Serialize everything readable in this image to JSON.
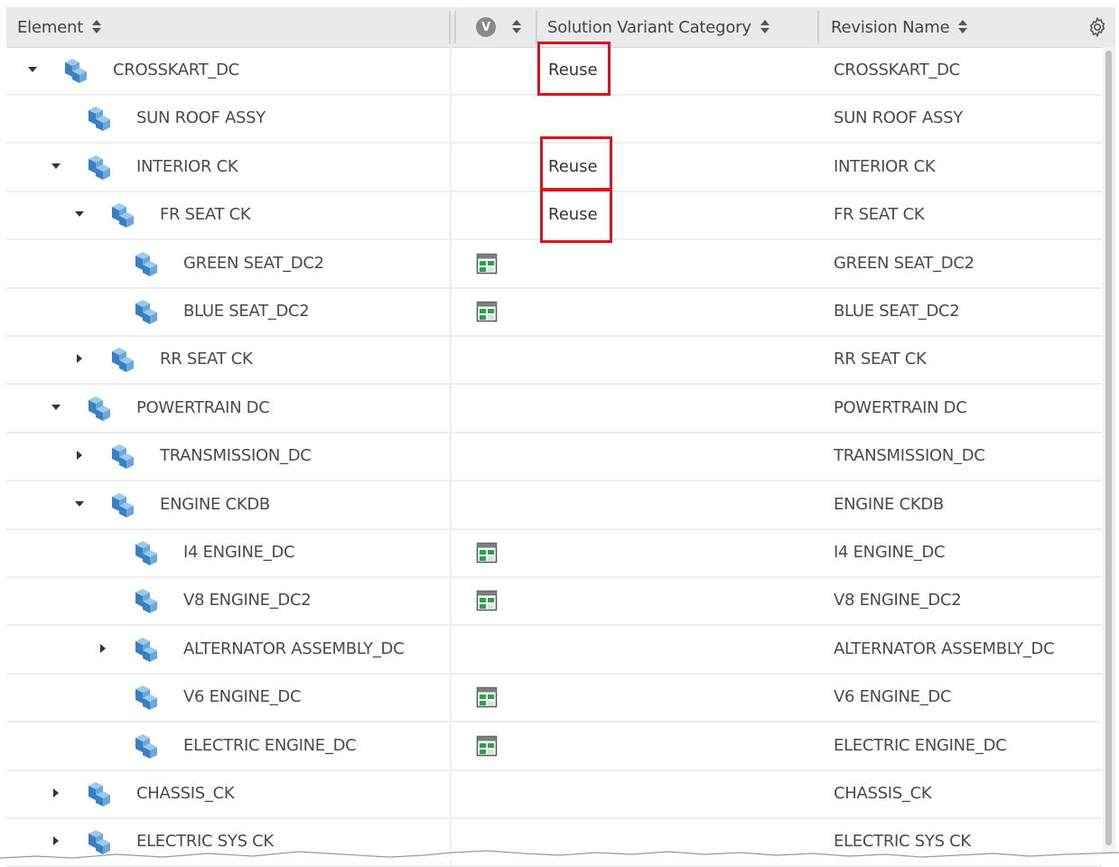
{
  "header": {
    "element_label": "Element",
    "variant_icon_glyph": "V",
    "category_label": "Solution Variant Category",
    "revision_label": "Revision Name"
  },
  "colors": {
    "highlight_box": "#e0101e",
    "header_bg": "#e9eaec",
    "icon_blue": "#3a7fc2",
    "icon_green": "#2e9f4a"
  },
  "rows": [
    {
      "element": "CROSSKART_DC",
      "revision": "CROSSKART_DC",
      "category": "Reuse",
      "twisty": "expanded",
      "level": 0,
      "variant_icon": false
    },
    {
      "element": "SUN ROOF ASSY",
      "revision": "SUN ROOF ASSY",
      "category": "",
      "twisty": "none",
      "level": 1,
      "variant_icon": false
    },
    {
      "element": "INTERIOR CK",
      "revision": "INTERIOR CK",
      "category": "Reuse",
      "twisty": "expanded",
      "level": 1,
      "variant_icon": false
    },
    {
      "element": "FR SEAT CK",
      "revision": "FR SEAT CK",
      "category": "Reuse",
      "twisty": "expanded",
      "level": 2,
      "variant_icon": false
    },
    {
      "element": "GREEN SEAT_DC2",
      "revision": "GREEN SEAT_DC2",
      "category": "",
      "twisty": "none",
      "level": 3,
      "variant_icon": true
    },
    {
      "element": "BLUE SEAT_DC2",
      "revision": "BLUE SEAT_DC2",
      "category": "",
      "twisty": "none",
      "level": 3,
      "variant_icon": true
    },
    {
      "element": "RR SEAT CK",
      "revision": "RR SEAT CK",
      "category": "",
      "twisty": "collapsed",
      "level": 2,
      "variant_icon": false
    },
    {
      "element": "POWERTRAIN DC",
      "revision": "POWERTRAIN DC",
      "category": "",
      "twisty": "expanded",
      "level": 1,
      "variant_icon": false
    },
    {
      "element": "TRANSMISSION_DC",
      "revision": "TRANSMISSION_DC",
      "category": "",
      "twisty": "collapsed",
      "level": 2,
      "variant_icon": false
    },
    {
      "element": "ENGINE CKDB",
      "revision": "ENGINE CKDB",
      "category": "",
      "twisty": "expanded",
      "level": 2,
      "variant_icon": false
    },
    {
      "element": "I4 ENGINE_DC",
      "revision": "I4 ENGINE_DC",
      "category": "",
      "twisty": "none",
      "level": 3,
      "variant_icon": true
    },
    {
      "element": "V8 ENGINE_DC2",
      "revision": "V8 ENGINE_DC2",
      "category": "",
      "twisty": "none",
      "level": 3,
      "variant_icon": true
    },
    {
      "element": "ALTERNATOR ASSEMBLY_DC",
      "revision": "ALTERNATOR ASSEMBLY_DC",
      "category": "",
      "twisty": "collapsed",
      "level": 3,
      "variant_icon": false
    },
    {
      "element": "V6 ENGINE_DC",
      "revision": "V6 ENGINE_DC",
      "category": "",
      "twisty": "none",
      "level": 3,
      "variant_icon": true
    },
    {
      "element": "ELECTRIC ENGINE_DC",
      "revision": "ELECTRIC ENGINE_DC",
      "category": "",
      "twisty": "none",
      "level": 3,
      "variant_icon": true
    },
    {
      "element": "CHASSIS_CK",
      "revision": "CHASSIS_CK",
      "category": "",
      "twisty": "collapsed",
      "level": 1,
      "variant_icon": false
    },
    {
      "element": "ELECTRIC SYS CK",
      "revision": "ELECTRIC SYS CK",
      "category": "",
      "twisty": "collapsed",
      "level": 1,
      "variant_icon": false
    }
  ]
}
